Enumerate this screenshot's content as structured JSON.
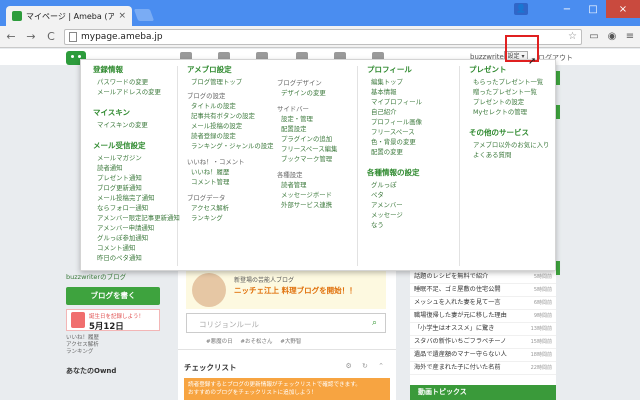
{
  "browser": {
    "tab_title": "マイページ | Ameba (アメーバ)",
    "tab_close": "×",
    "url": "mypage.ameba.jp",
    "win_min": "−",
    "win_max": "□",
    "win_close": "×",
    "back": "←",
    "forward": "→",
    "reload": "C",
    "star": "☆"
  },
  "header": {
    "user_link": "buzzwriter ▾",
    "settings_label": "設定 ▾",
    "logout_label": "ログアウト"
  },
  "megamenu": {
    "col1": {
      "sections": [
        {
          "title": "登録情報",
          "items": [
            "パスワードの変更",
            "メールアドレスの変更"
          ]
        },
        {
          "title": "マイスキン",
          "items": [
            "マイスキンの変更"
          ]
        },
        {
          "title": "メール受信設定",
          "items": [
            "メールマガジン",
            "読者通知",
            "プレゼント通知",
            "ブログ更新通知",
            "メール投稿完了通知",
            "ならフォロー通知",
            "アメンバー限定記事更新通知",
            "アメンバー申請通知",
            "グルっぽ参加通知",
            "コメント通知",
            "昨日のペタ通知"
          ]
        }
      ]
    },
    "col2": {
      "title": "アメブロ設定",
      "top": "ブログ管理トップ",
      "groups": [
        {
          "sub": "ブログの設定",
          "items": [
            "タイトルの設定",
            "記事共有ボタンの設定",
            "メール投稿の設定",
            "読者登録の設定",
            "ランキング・ジャンルの設定"
          ]
        },
        {
          "sub": "いいね！・コメント",
          "items": [
            "いいね！履歴",
            "コメント管理"
          ]
        },
        {
          "sub": "ブログデータ",
          "items": [
            "アクセス解析",
            "ランキング"
          ]
        }
      ]
    },
    "col3": {
      "groups": [
        {
          "sub": "ブログデザイン",
          "items": [
            "デザインの変更"
          ]
        },
        {
          "sub": "サイドバー",
          "items": [
            "設定・管理",
            "配置設定",
            "プラグインの追加",
            "フリースペース編集",
            "ブックマーク管理"
          ]
        },
        {
          "sub": "各種設定",
          "items": [
            "読者管理",
            "メッセージボード",
            "外部サービス連携"
          ]
        }
      ]
    },
    "col4": {
      "sections": [
        {
          "title": "プロフィール",
          "items": [
            "編集トップ",
            "基本情報",
            "マイプロフィール",
            "自己紹介",
            "プロフィール画像",
            "フリースペース",
            "色・背景の変更",
            "配置の変更"
          ]
        },
        {
          "title": "各種情報の設定",
          "items": [
            "グルっぽ",
            "ペタ",
            "アメンバー",
            "メッセージ",
            "なう"
          ]
        }
      ]
    },
    "col5": {
      "sections": [
        {
          "title": "プレゼント",
          "items": [
            "もらったプレゼント一覧",
            "贈ったプレゼント一覧",
            "プレゼントの設定",
            "Myセレクトの管理"
          ]
        },
        {
          "title": "その他のサービス",
          "items": [
            "アメブロ以外のお気に入り",
            "よくある質問"
          ]
        }
      ]
    }
  },
  "left": {
    "blog_link": "buzzwriterのブログ",
    "write_button": "ブログを書く",
    "date_caption": "誕生日を記録しよう！",
    "date_value": "5月12日",
    "stats": [
      "いいね！履歴",
      "アクセス解析",
      "ランキング"
    ],
    "ownd_title": "あなたのOwnd"
  },
  "center": {
    "newblog_caption": "新登場の芸能人ブログ",
    "newblog_title": "ニッチェ江上 料理ブログを開始！！",
    "search_placeholder": "コリジョンルール",
    "tags": [
      "#悪魔の日",
      "#おそ松さん",
      "#大野智"
    ],
    "checklist_title": "チェックリスト",
    "checklist_icons": "⚙ ↻ ⌃",
    "notice_line1": "読者登録するとブログの更新情報がチェックリストで確認できます。",
    "notice_line2": "おすすめのブログをチェックリストに追加しよう！"
  },
  "right": {
    "news": [
      {
        "text": "話題のレシピを無料で紹介",
        "time": "5時間前"
      },
      {
        "text": "睡眠不足、ゴミ屋敷の住宅公開",
        "time": "5時間前"
      },
      {
        "text": "メッシュを入れた妻を見て一言",
        "time": "6時間前"
      },
      {
        "text": "職場復帰した妻が元に移した理由",
        "time": "9時間前"
      },
      {
        "text": "「小学生はオススメ」に驚き",
        "time": "13時間前"
      },
      {
        "text": "スタバの新作いちごフラペチーノ",
        "time": "15時間前"
      },
      {
        "text": "遺品で遺産額のマナー守らない人",
        "time": "18時間前"
      },
      {
        "text": "海外で産まれた子に付いた名前",
        "time": "22時間前"
      }
    ],
    "movie_topics": "動画トピックス"
  }
}
